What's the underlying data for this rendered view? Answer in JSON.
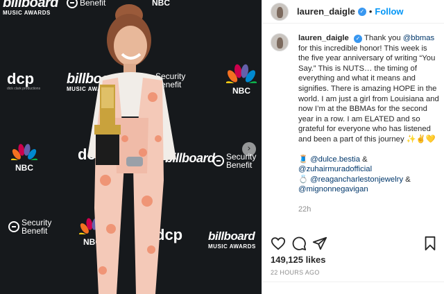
{
  "photo": {
    "backdrop": {
      "billboard_word": "billboard",
      "billboard_sub": "MUSIC AWARDS",
      "dcp_word": "dcp",
      "dcp_sub": "dick clark productions",
      "nbc_word": "NBC",
      "security_word1": "Security",
      "security_word2": "Benefit",
      "colors": {
        "backdrop": "#16191c",
        "peacock": [
          "#fccc12",
          "#f37021",
          "#cc004c",
          "#6460aa",
          "#0089d0",
          "#0db14b"
        ],
        "suit_base": "#f4c9b8",
        "suit_pattern": "#ef8c6b"
      }
    },
    "next_arrow_icon": "chevron-right-icon",
    "next_arrow_glyph": "›"
  },
  "header": {
    "username": "lauren_daigle",
    "verified_glyph": "✓",
    "separator": "•",
    "follow_label": "Follow"
  },
  "caption": {
    "username": "lauren_daigle",
    "verified_glyph": "✓",
    "mention_bbmas": "@bbmas",
    "text_before": "Thank you ",
    "text_after": " for this incredible honor! This week is the five year anniversary of writing “You Say.” This is NUTS… the timing of everything and what it means and signifies. There is amazing HOPE in the world. I am just a girl from Louisiana and now I’m at the BBMAs for the second year in a row. I am ELATED and so grateful for everyone who has listened and been a part of this journey ✨✌️💛",
    "credit1_emoji": "🧵",
    "credit1_a": "@dulce.bestia",
    "credit1_and": " & ",
    "credit1_b": "@zuhairmuradofficial",
    "credit2_emoji": "💍",
    "credit2_a": "@reagancharlestonjewelry",
    "credit2_and": " & ",
    "credit2_b": "@mignonnegavigan",
    "time": "22h"
  },
  "actions": {
    "like_icon": "heart-icon",
    "comment_icon": "comment-icon",
    "share_icon": "send-icon",
    "save_icon": "bookmark-icon"
  },
  "likes_text": "149,125 likes",
  "posted_ago": "22 HOURS AGO",
  "accent_colors": {
    "link_blue": "#0095f6",
    "mention_blue": "#00376b",
    "muted_gray": "#8e8e8e",
    "verified_blue": "#3897f0"
  }
}
